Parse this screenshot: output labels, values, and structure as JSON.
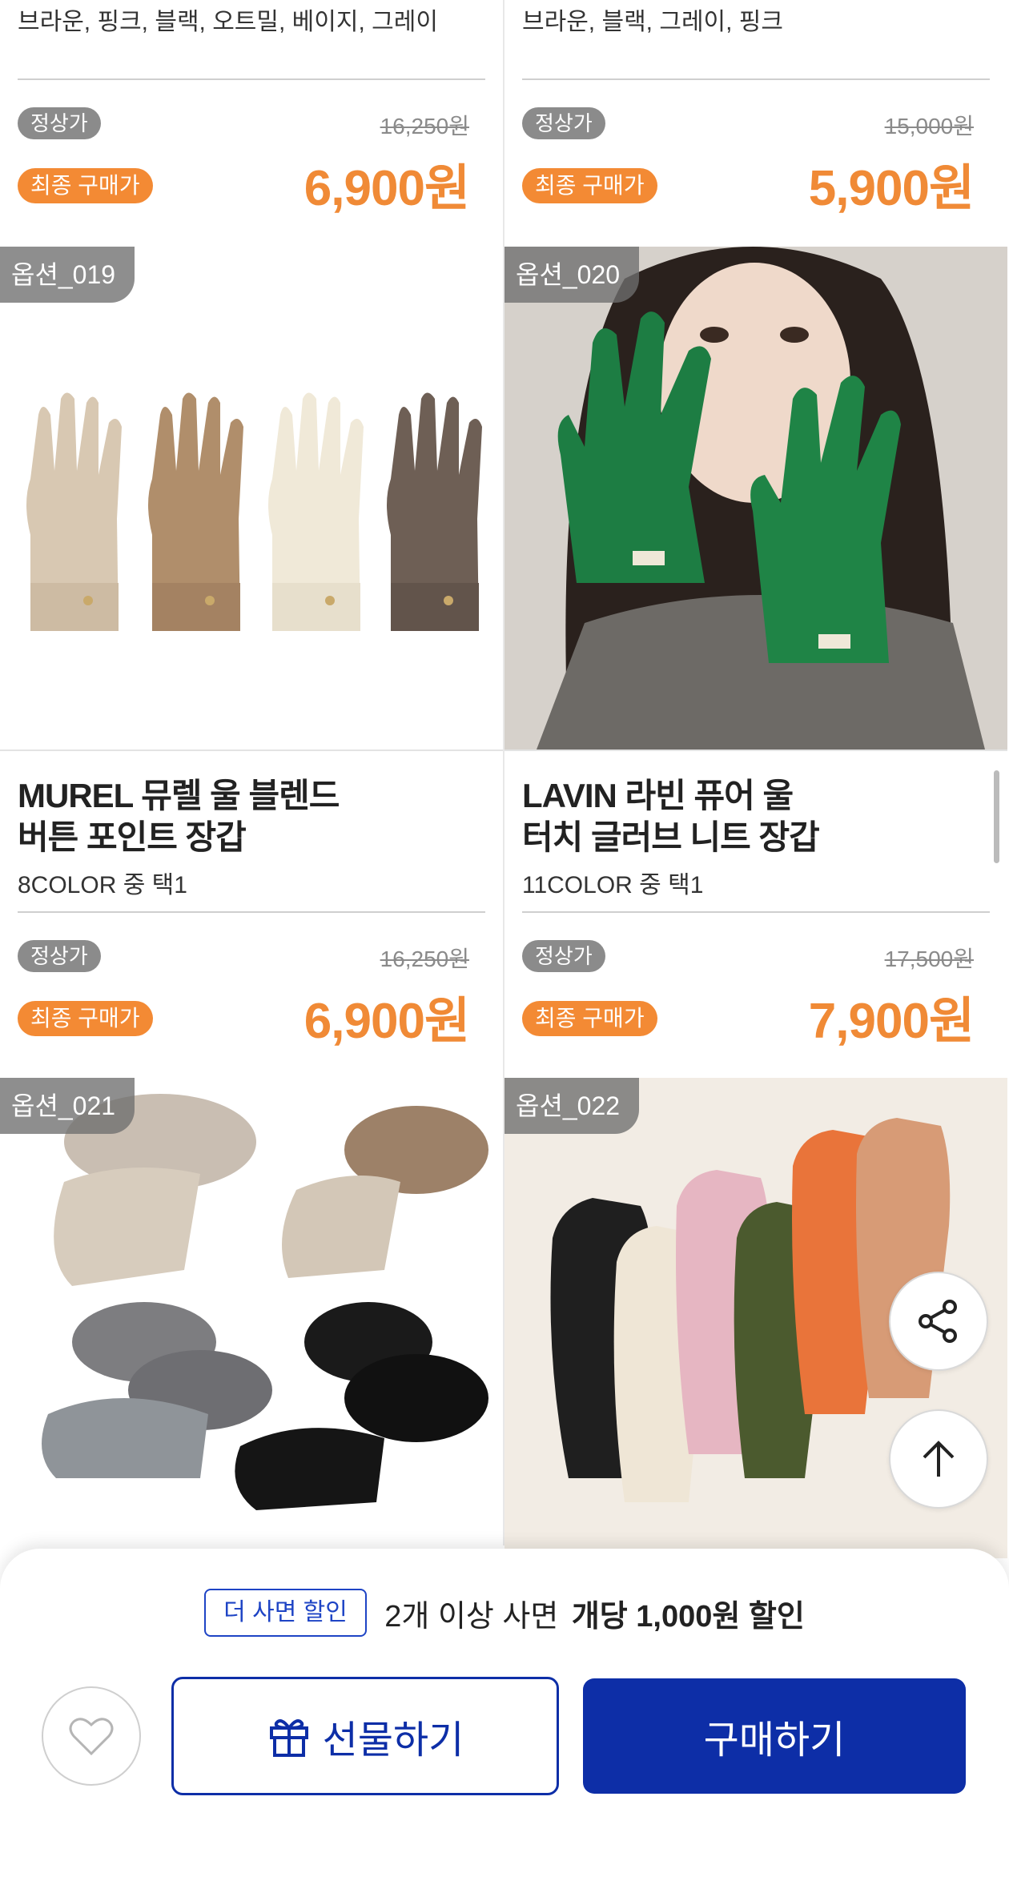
{
  "products_top": [
    {
      "colors_text": "브라운, 핑크, 블랙, 오트밀, 베이지, 그레이",
      "regular_label": "정상가",
      "regular_price": "16,250원",
      "final_label": "최종 구매가",
      "final_price": "6,900원"
    },
    {
      "colors_text": "브라운, 블랙, 그레이, 핑크",
      "regular_label": "정상가",
      "regular_price": "15,000원",
      "final_label": "최종 구매가",
      "final_price": "5,900원"
    }
  ],
  "products_mid": [
    {
      "option": "옵션_019",
      "title_line1": "MUREL 뮤렐 울 블렌드",
      "title_line2": "버튼 포인트 장갑",
      "subtitle": "8COLOR 중 택1",
      "regular_label": "정상가",
      "regular_price": "16,250원",
      "final_label": "최종 구매가",
      "final_price": "6,900원"
    },
    {
      "option": "옵션_020",
      "title_line1": "LAVIN 라빈 퓨어 울",
      "title_line2": "터치 글러브 니트 장갑",
      "subtitle": "11COLOR 중 택1",
      "regular_label": "정상가",
      "regular_price": "17,500원",
      "final_label": "최종 구매가",
      "final_price": "7,900원"
    }
  ],
  "products_bottom": [
    {
      "option": "옵션_021"
    },
    {
      "option": "옵션_022"
    }
  ],
  "floating": {
    "share_icon": "share-icon",
    "top_icon": "arrow-up-icon"
  },
  "bottom_sheet": {
    "promo_badge": "더 사면 할인",
    "promo_text": "2개 이상 사면",
    "promo_strong": "개당 1,000원 할인",
    "gift_label": "선물하기",
    "buy_label": "구매하기",
    "heart_icon": "heart-icon",
    "gift_icon": "gift-icon"
  },
  "colors": {
    "accent_orange": "#f38a34",
    "brand_blue": "#0d2ea7",
    "gray_pill": "#8b8b8b"
  }
}
